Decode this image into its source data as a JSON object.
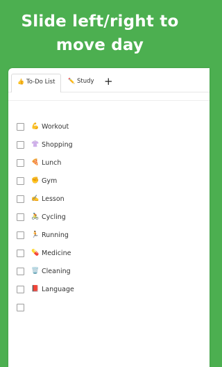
{
  "headline": {
    "line1": "Slide left/right to",
    "line2": "move day"
  },
  "tabs": [
    {
      "icon": "👍",
      "label": "To-Do List"
    },
    {
      "icon": "✏️",
      "label": "Study"
    }
  ],
  "add_tab": "+",
  "items": [
    {
      "emoji": "💪",
      "label": "Workout"
    },
    {
      "emoji": "👚",
      "label": "Shopping"
    },
    {
      "emoji": "🍕",
      "label": "Lunch"
    },
    {
      "emoji": "✊",
      "label": "Gym"
    },
    {
      "emoji": "✍️",
      "label": "Lesson"
    },
    {
      "emoji": "🚴",
      "label": "Cycling"
    },
    {
      "emoji": "🏃",
      "label": "Running"
    },
    {
      "emoji": "💊",
      "label": "Medicine"
    },
    {
      "emoji": "🗑️",
      "label": "Cleaning"
    },
    {
      "emoji": "📕",
      "label": "Language"
    },
    {
      "emoji": "",
      "label": ""
    }
  ]
}
